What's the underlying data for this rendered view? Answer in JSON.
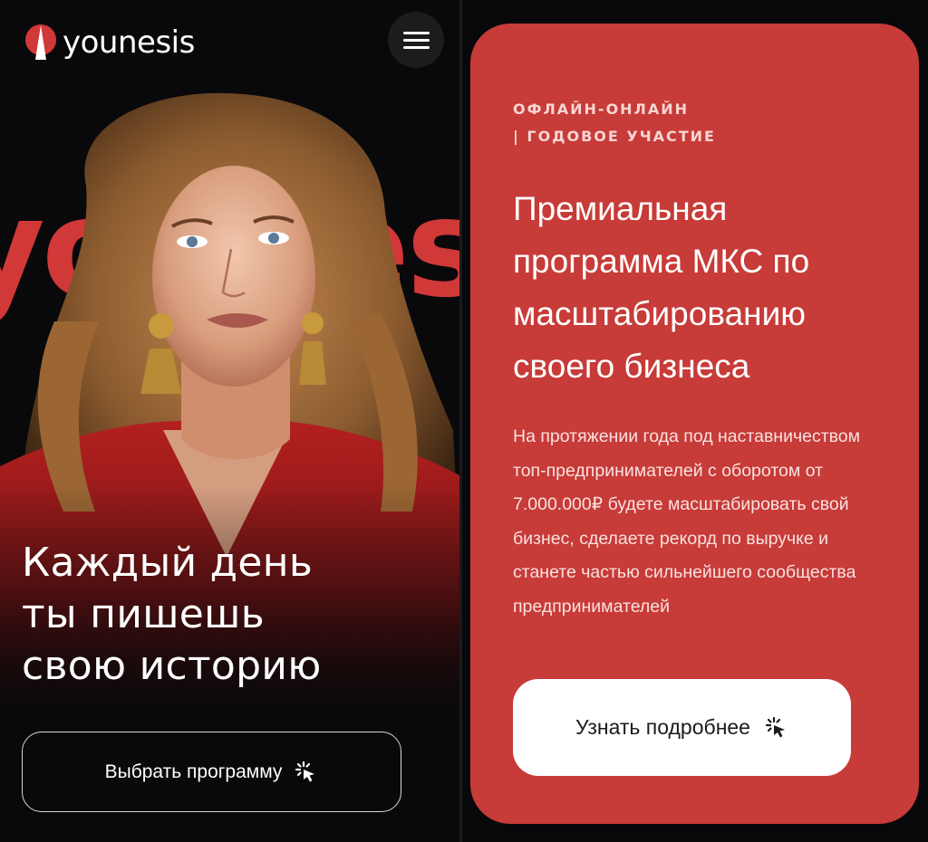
{
  "brand": {
    "name": "younesis",
    "accent": "#d13838",
    "card_color": "#c73b38",
    "background": "#09090b"
  },
  "left": {
    "background_word": "younesis",
    "hero_lines": [
      "Каждый день",
      "ты пишешь",
      "свою историю"
    ],
    "cta_label": "Выбрать программу",
    "cta_icon": "click-cursor-icon"
  },
  "header": {
    "menu_icon": "hamburger-icon"
  },
  "card": {
    "eyebrow_line1": "ОФЛАЙН-ОНЛАЙН",
    "eyebrow_line2": "| ГОДОВОЕ УЧАСТИЕ",
    "title_lines": [
      "Премиальная",
      "программа МКС по",
      "масштабированию",
      "своего бизнеса"
    ],
    "description_lines": [
      "На протяжении года под наставничеством",
      "топ-предпринимателей с оборотом от",
      "7.000.000₽ будете масштабировать свой",
      "бизнес, сделаете рекорд по выручке и",
      "станете частью сильнейшего сообщества",
      "предпринимателей"
    ],
    "cta_label": "Узнать подробнее",
    "cta_icon": "click-cursor-icon"
  }
}
